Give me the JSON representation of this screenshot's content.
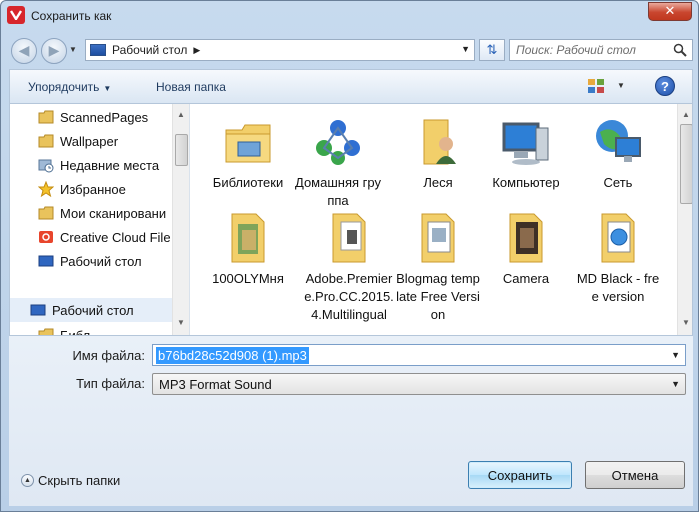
{
  "window": {
    "title": "Сохранить как",
    "close_label": "✕"
  },
  "address": {
    "crumb": "Рабочий стол",
    "search_placeholder": "Поиск: Рабочий стол"
  },
  "toolbar": {
    "organize_label": "Упорядочить",
    "new_folder_label": "Новая папка",
    "help_label": "?"
  },
  "sidebar": {
    "items": [
      {
        "label": "ScannedPages",
        "icon": "folder-icon"
      },
      {
        "label": "Wallpaper",
        "icon": "folder-icon"
      },
      {
        "label": "Недавние места",
        "icon": "recent-places-icon"
      },
      {
        "label": "Избранное",
        "icon": "star-icon"
      },
      {
        "label": "Мои сканировани",
        "icon": "folder-icon"
      },
      {
        "label": "Creative Cloud File",
        "icon": "creative-cloud-icon"
      },
      {
        "label": "Рабочий стол",
        "icon": "desktop-icon"
      }
    ],
    "section_label": "Рабочий стол",
    "partial_label": "Библ"
  },
  "files": [
    {
      "label": "Библиотеки",
      "icon": "libraries-folder-icon"
    },
    {
      "label": "Домашняя группа",
      "icon": "homegroup-icon"
    },
    {
      "label": "Леся",
      "icon": "user-folder-icon"
    },
    {
      "label": "Компьютер",
      "icon": "computer-icon"
    },
    {
      "label": "Сеть",
      "icon": "network-icon"
    },
    {
      "label": "100OLYMня",
      "icon": "photo-folder-icon"
    },
    {
      "label": "Adobe.Premiere.Pro.CC.2015.4.Multilingual",
      "icon": "document-folder-icon"
    },
    {
      "label": "Blogmag template Free Version",
      "icon": "document-folder-icon"
    },
    {
      "label": "Camera",
      "icon": "camera-folder-icon"
    },
    {
      "label": "MD Black - free version",
      "icon": "safari-folder-icon"
    }
  ],
  "form": {
    "filename_label": "Имя файла:",
    "filename_value": "b76bd28c52d908 (1).mp3",
    "filetype_label": "Тип файла:",
    "filetype_value": "MP3 Format Sound"
  },
  "footer": {
    "hide_folders_label": "Скрыть папки",
    "save_label": "Сохранить",
    "cancel_label": "Отмена"
  }
}
